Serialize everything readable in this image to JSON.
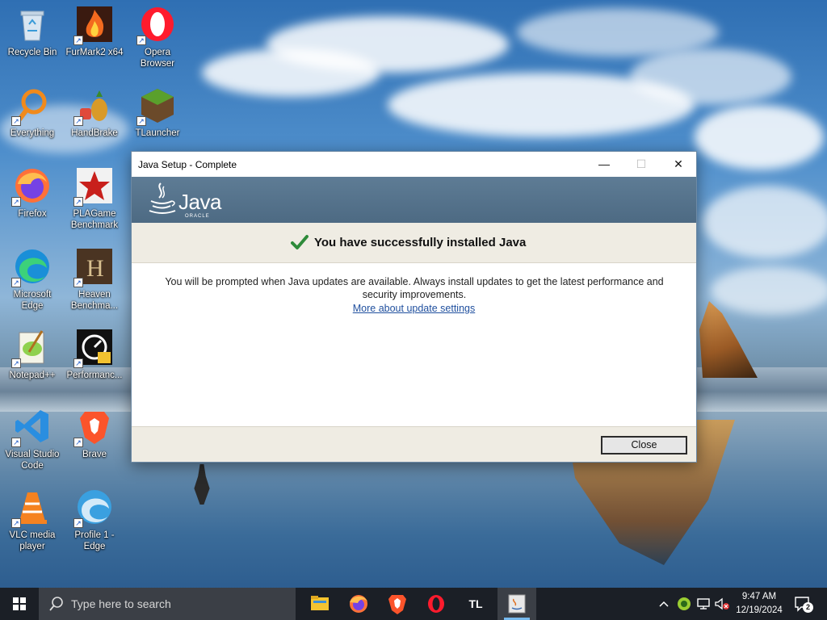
{
  "desktop": {
    "icons": [
      {
        "label": "Recycle Bin"
      },
      {
        "label": "FurMark2 x64"
      },
      {
        "label": "Opera Browser"
      },
      {
        "label": "Everything"
      },
      {
        "label": "HandBrake"
      },
      {
        "label": "TLauncher"
      },
      {
        "label": "Firefox"
      },
      {
        "label": "PLAGame Benchmark"
      },
      {
        "label": "Microsoft Edge"
      },
      {
        "label": "Heaven Benchma..."
      },
      {
        "label": "Notepad++"
      },
      {
        "label": "Performanc..."
      },
      {
        "label": "Visual Studio Code"
      },
      {
        "label": "Brave"
      },
      {
        "label": "VLC media player"
      },
      {
        "label": "Profile 1 - Edge"
      }
    ]
  },
  "dialog": {
    "title": "Java Setup - Complete",
    "minimize_glyph": "—",
    "maximize_glyph": "☐",
    "close_glyph": "✕",
    "logo_word": "Java",
    "logo_sub": "ORACLE",
    "success_message": "You have successfully installed Java",
    "body_text": "You will be prompted when Java updates are available. Always install updates to get the latest performance and security improvements.",
    "link_text": "More about update settings",
    "close_button": "Close"
  },
  "taskbar": {
    "search_placeholder": "Type here to search",
    "apps": [
      {
        "name": "file-explorer-icon"
      },
      {
        "name": "firefox-icon"
      },
      {
        "name": "brave-icon"
      },
      {
        "name": "opera-icon"
      },
      {
        "name": "tlauncher-icon",
        "text": "TL"
      },
      {
        "name": "java-setup-icon"
      }
    ],
    "time": "9:47 AM",
    "date": "12/19/2024",
    "notification_count": "2"
  }
}
